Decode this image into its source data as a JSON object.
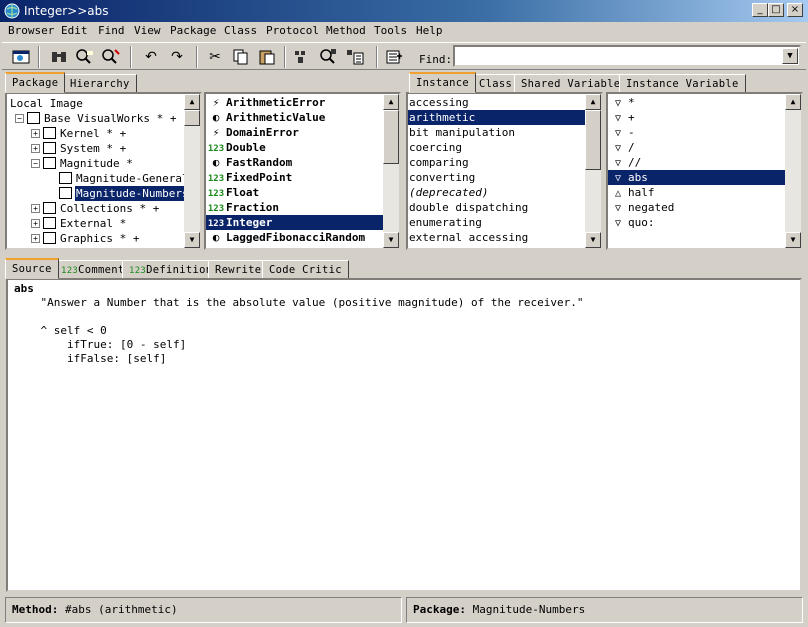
{
  "window": {
    "title": "Integer>>abs"
  },
  "menu": [
    "Browser",
    "Edit",
    "Find",
    "View",
    "Package",
    "Class",
    "Protocol",
    "Method",
    "Tools",
    "Help"
  ],
  "find": {
    "label": "Find:",
    "value": ""
  },
  "package_tabs": [
    "Package",
    "Hierarchy"
  ],
  "package_tree": [
    {
      "label": "Local Image",
      "indent": 0,
      "box": "",
      "icon": false
    },
    {
      "label": "Base VisualWorks * +",
      "indent": 1,
      "box": "−",
      "icon": true
    },
    {
      "label": "Kernel * +",
      "indent": 2,
      "box": "+",
      "icon": true
    },
    {
      "label": "System * +",
      "indent": 2,
      "box": "+",
      "icon": true
    },
    {
      "label": "Magnitude *",
      "indent": 2,
      "box": "−",
      "icon": true
    },
    {
      "label": "Magnitude-General",
      "indent": 3,
      "box": "",
      "icon": true
    },
    {
      "label": "Magnitude-Numbers",
      "indent": 3,
      "box": "",
      "icon": true,
      "selected": true
    },
    {
      "label": "Collections * +",
      "indent": 2,
      "box": "+",
      "icon": true
    },
    {
      "label": "External *",
      "indent": 2,
      "box": "+",
      "icon": true
    },
    {
      "label": "Graphics * +",
      "indent": 2,
      "box": "+",
      "icon": true
    }
  ],
  "classes": [
    {
      "icon": "⚡",
      "name": "ArithmeticError"
    },
    {
      "icon": "◐",
      "name": "ArithmeticValue"
    },
    {
      "icon": "⚡",
      "name": "DomainError"
    },
    {
      "icon": "123",
      "name": "Double"
    },
    {
      "icon": "◐",
      "name": "FastRandom"
    },
    {
      "icon": "123",
      "name": "FixedPoint"
    },
    {
      "icon": "123",
      "name": "Float"
    },
    {
      "icon": "123",
      "name": "Fraction"
    },
    {
      "icon": "123",
      "name": "Integer",
      "selected": true
    },
    {
      "icon": "◐",
      "name": "LaggedFibonacciRandom"
    }
  ],
  "protocol_tabs": [
    "Instance",
    "Class",
    "Shared Variable",
    "Instance Variable"
  ],
  "protocols": [
    {
      "label": "accessing"
    },
    {
      "label": "arithmetic",
      "selected": true
    },
    {
      "label": "bit manipulation"
    },
    {
      "label": "coercing"
    },
    {
      "label": "comparing"
    },
    {
      "label": "converting"
    },
    {
      "label": "(deprecated)",
      "italic": true
    },
    {
      "label": "double dispatching"
    },
    {
      "label": "enumerating"
    },
    {
      "label": "external accessing"
    }
  ],
  "methods": [
    {
      "label": "*",
      "icon": "▽"
    },
    {
      "label": "+",
      "icon": "▽"
    },
    {
      "label": "-",
      "icon": "▽"
    },
    {
      "label": "/",
      "icon": "▽"
    },
    {
      "label": "//",
      "icon": "▽"
    },
    {
      "label": "abs",
      "icon": "▽",
      "selected": true
    },
    {
      "label": "half",
      "icon": "△"
    },
    {
      "label": "negated",
      "icon": "▽"
    },
    {
      "label": "quo:",
      "icon": "▽"
    }
  ],
  "code_tabs": [
    "Source",
    "Comment",
    "Definition",
    "Rewrite",
    "Code Critic"
  ],
  "code_tab_badges": {
    "Comment": "123",
    "Definition": "123"
  },
  "source": {
    "selector": "abs",
    "body": "    \"Answer a Number that is the absolute value (positive magnitude) of the receiver.\"\n\n    ^ self < 0\n        ifTrue: [0 - self]\n        ifFalse: [self]"
  },
  "status": {
    "method_label": "Method:",
    "method_value": "#abs (arithmetic)",
    "package_label": "Package:",
    "package_value": "Magnitude-Numbers"
  },
  "colors": {
    "selection": "#0a246a",
    "active_tab": "#f0a030",
    "badge_green": "#1a8a1a"
  }
}
